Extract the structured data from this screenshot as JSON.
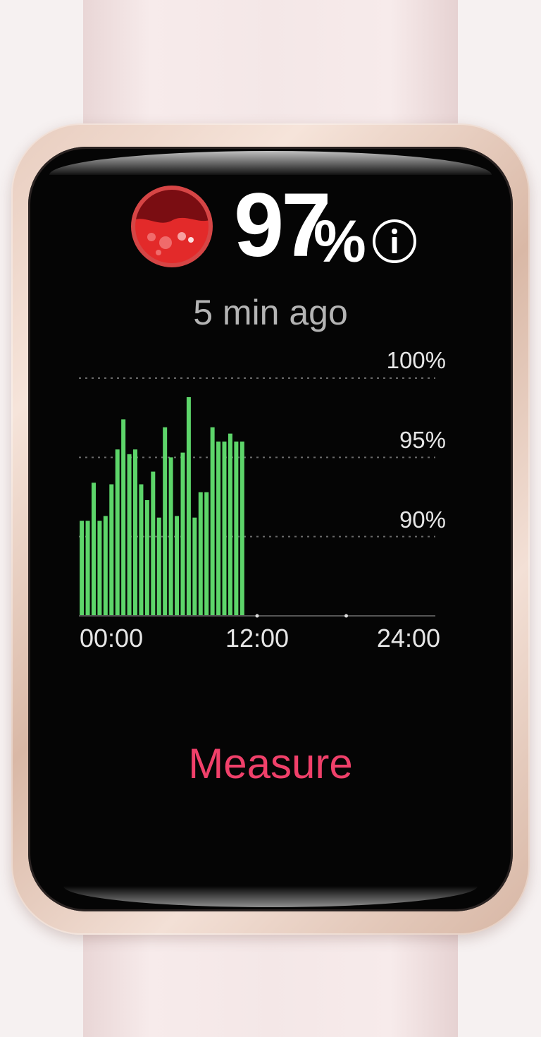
{
  "device": {
    "strap_color": "#f4e7e7",
    "case_color": "#e5c8b8",
    "screen_color": "#000000"
  },
  "reading": {
    "value": "97",
    "unit": "%",
    "icon": "blood-oxygen-icon",
    "info_icon": "info-icon",
    "timestamp": "5 min ago"
  },
  "chart_data": {
    "type": "bar",
    "title": "",
    "xlabel": "",
    "ylabel": "",
    "x_ticks": [
      "00:00",
      "12:00",
      "24:00"
    ],
    "y_ticks": [
      "100%",
      "95%",
      "90%"
    ],
    "xlim": [
      0,
      24
    ],
    "ylim": [
      85,
      100
    ],
    "grid": true,
    "bar_color": "#5dd56a",
    "x": [
      0.1,
      0.5,
      0.9,
      1.3,
      1.7,
      2.1,
      2.5,
      2.9,
      3.3,
      3.7,
      4.1,
      4.5,
      4.9,
      5.3,
      5.7,
      6.1,
      6.5,
      6.9,
      7.3,
      7.7,
      8.1,
      8.5,
      8.9,
      9.3,
      9.7,
      10.1,
      10.5,
      10.9
    ],
    "values": [
      91,
      91,
      93.4,
      91,
      91.3,
      93.3,
      95.5,
      97.4,
      95.2,
      95.5,
      93.3,
      92.3,
      94.1,
      91.2,
      96.9,
      95.0,
      91.3,
      95.3,
      98.8,
      91.2,
      92.8,
      92.8,
      96.9,
      96.0,
      96.0,
      96.5,
      96.0,
      96.0
    ],
    "markers": [
      12,
      18
    ]
  },
  "actions": {
    "measure_label": "Measure",
    "measure_color": "#f0406a"
  }
}
